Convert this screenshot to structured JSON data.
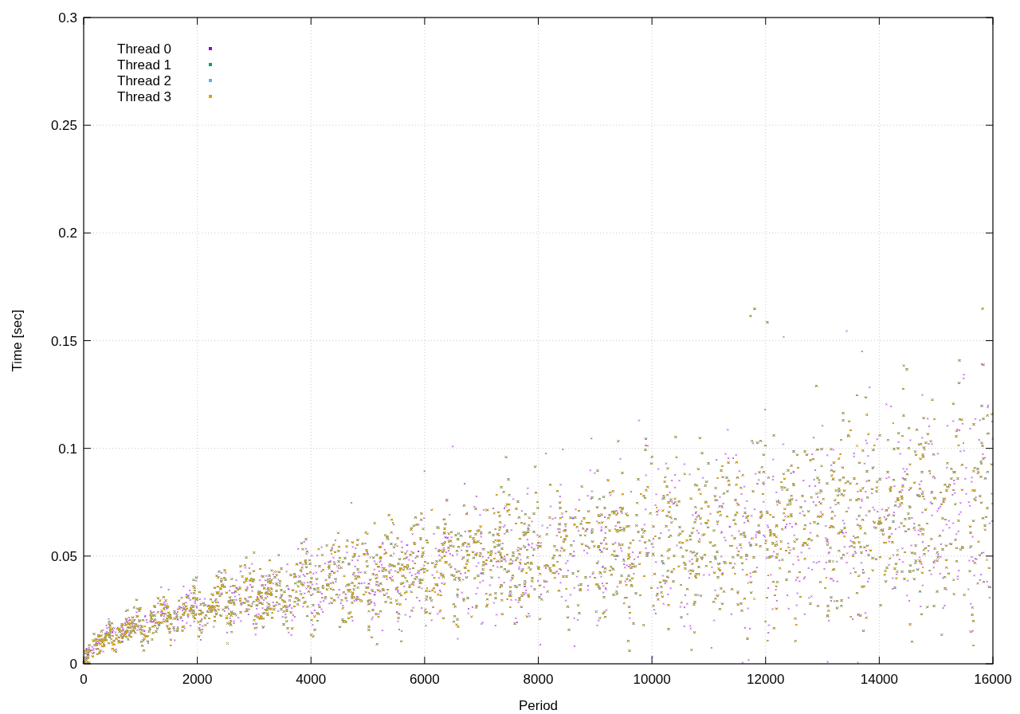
{
  "plot": {
    "y_tick_labels": [
      "0.3",
      "0.25",
      "0.2",
      "0.15",
      "0.1",
      "0.05",
      "0"
    ],
    "y_axis_title": "Time [sec]",
    "x_axis_title": "Period",
    "x_tick_labels": [
      "0",
      "2000",
      "4000",
      "6000",
      "8000",
      "10000",
      "12000",
      "14000",
      "16000"
    ],
    "legend": [
      {
        "label": "Thread 0",
        "color": "#9400d3"
      },
      {
        "label": "Thread 1",
        "color": "#009e73"
      },
      {
        "label": "Thread 2",
        "color": "#56b4e9"
      },
      {
        "label": "Thread 3",
        "color": "#e69f00"
      }
    ]
  }
}
